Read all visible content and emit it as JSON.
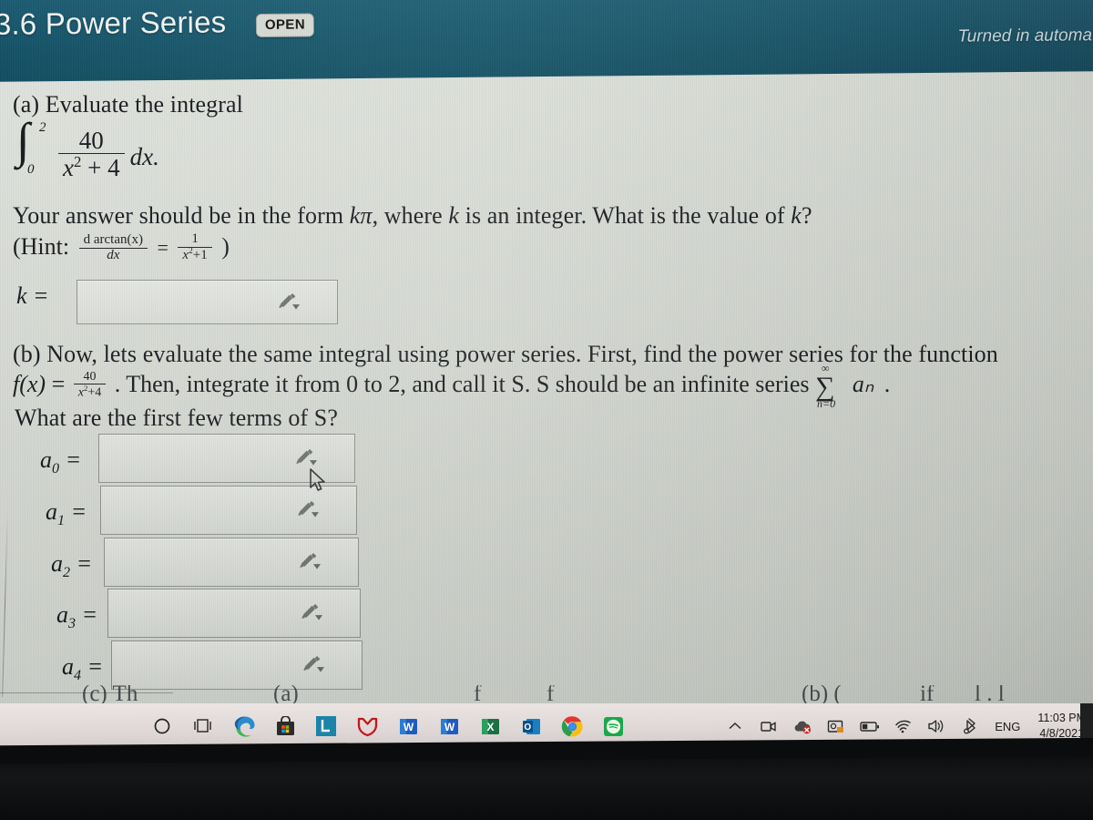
{
  "header": {
    "title": "3.6 Power Series",
    "status_badge": "OPEN",
    "submission_note": "Turned in automatic",
    "bg_color": "#13596f",
    "badge_bg": "#d7dad4"
  },
  "problem": {
    "part_a": {
      "label": "(a)",
      "prompt": "Evaluate the integral",
      "integral": {
        "lower_limit": "0",
        "upper_limit": "2",
        "numerator": "40",
        "denominator": "x² + 4",
        "differential": "dx."
      },
      "instruction_1": "Your answer should be in the form",
      "instruction_form": "kπ",
      "instruction_2": ", where",
      "instruction_var": "k",
      "instruction_3": "is an integer. What is the value of",
      "instruction_var2": "k",
      "instruction_4": "?",
      "hint_open": "(Hint:",
      "hint_num": "d arctan(x)",
      "hint_den": "dx",
      "hint_eq": "=",
      "hint_rhs_num": "1",
      "hint_rhs_den": "x²+1",
      "hint_close": ")",
      "answer_label": "k =",
      "answer_value": ""
    },
    "part_b": {
      "label": "(b)",
      "text_1": "Now, lets evaluate the same integral using power series. First, find the power series for the function",
      "fn_name": "f(x)",
      "fn_eq": "=",
      "fn_num": "40",
      "fn_den": "x²+4",
      "text_2": ". Then, integrate it from 0 to 2, and call it S. S should be an infinite series",
      "series_symbol": "∑",
      "series_upper": "∞",
      "series_lower": "n=0",
      "series_term": "aₙ",
      "text_3": ".",
      "text_4": "What are the first few terms of S?",
      "answers": [
        {
          "label": "a₀ =",
          "sub": "0",
          "value": ""
        },
        {
          "label": "a₁ =",
          "sub": "1",
          "value": ""
        },
        {
          "label": "a₂ =",
          "sub": "2",
          "value": ""
        },
        {
          "label": "a₃ =",
          "sub": "3",
          "value": ""
        },
        {
          "label": "a₄ =",
          "sub": "4",
          "value": ""
        }
      ]
    }
  },
  "taskbar": {
    "apps": [
      {
        "name": "cortana-search",
        "glyph": "circle",
        "active": false
      },
      {
        "name": "task-view",
        "glyph": "taskview",
        "active": false
      },
      {
        "name": "microsoft-edge",
        "glyph": "edge",
        "active": false
      },
      {
        "name": "microsoft-store",
        "glyph": "store",
        "active": false
      },
      {
        "name": "lockdown-browser",
        "glyph": "L",
        "active": false
      },
      {
        "name": "mcafee",
        "glyph": "shield",
        "active": false
      },
      {
        "name": "word",
        "glyph": "W",
        "active": false
      },
      {
        "name": "word-doc",
        "glyph": "W",
        "active": false
      },
      {
        "name": "excel",
        "glyph": "X",
        "active": false
      },
      {
        "name": "outlook",
        "glyph": "O",
        "active": false
      },
      {
        "name": "google-chrome",
        "glyph": "chrome",
        "active": true
      },
      {
        "name": "spotify",
        "glyph": "spotify",
        "active": true
      }
    ],
    "tray": [
      {
        "name": "show-hidden-icons",
        "glyph": "chevron-up"
      },
      {
        "name": "camera",
        "glyph": "camera"
      },
      {
        "name": "onedrive-error",
        "glyph": "cloud-x"
      },
      {
        "name": "screen-snip",
        "glyph": "photo"
      },
      {
        "name": "battery",
        "glyph": "battery"
      },
      {
        "name": "wifi",
        "glyph": "wifi"
      },
      {
        "name": "volume",
        "glyph": "speaker"
      },
      {
        "name": "bluetooth-pen",
        "glyph": "pen"
      }
    ],
    "language": "ENG",
    "time": "11:03 PM",
    "date": "4/8/2021",
    "accent_color": "#e8821f"
  }
}
